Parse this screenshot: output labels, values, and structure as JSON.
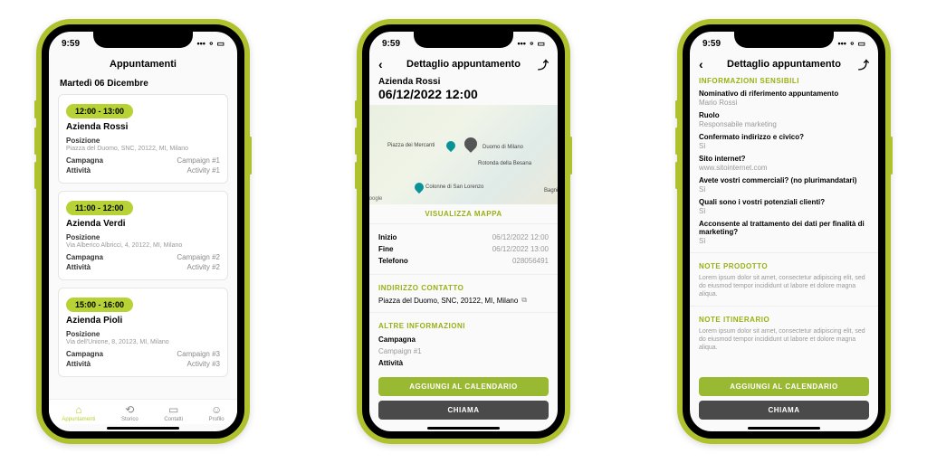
{
  "status_time": "9:59",
  "phone1": {
    "header": "Appuntamenti",
    "date": "Martedì 06 Dicembre",
    "cards": [
      {
        "time": "12:00 - 13:00",
        "company": "Azienda Rossi",
        "pos_l": "Posizione",
        "pos_v": "Piazza del Duomo, SNC, 20122, MI, Milano",
        "camp_l": "Campagna",
        "camp_v": "Campaign #1",
        "act_l": "Attività",
        "act_v": "Activity #1"
      },
      {
        "time": "11:00 - 12:00",
        "company": "Azienda Verdi",
        "pos_l": "Posizione",
        "pos_v": "Via Alberico Albricci, 4, 20122, MI, Milano",
        "camp_l": "Campagna",
        "camp_v": "Campaign #2",
        "act_l": "Attività",
        "act_v": "Activity #2"
      },
      {
        "time": "15:00 - 16:00",
        "company": "Azienda Pioli",
        "pos_l": "Posizione",
        "pos_v": "Via dell'Unione, 8, 20123, MI, Milano",
        "camp_l": "Campagna",
        "camp_v": "Campaign #3",
        "act_l": "Attività",
        "act_v": "Activity #3"
      }
    ],
    "nav": [
      "Appuntamenti",
      "Storico",
      "Contatti",
      "Profilo"
    ]
  },
  "phone2": {
    "header": "Dettaglio appuntamento",
    "company": "Azienda Rossi",
    "datetime": "06/12/2022 12:00",
    "map_labels": {
      "a": "Piazza dei Mercanti",
      "b": "Duomo di Milano",
      "c": "Rotonda della Besana",
      "d": "Colonne di San Lorenzo",
      "e": "Bagni M"
    },
    "map_btn": "VISUALIZZA MAPPA",
    "kv": [
      {
        "k": "Inizio",
        "v": "06/12/2022 12:00"
      },
      {
        "k": "Fine",
        "v": "06/12/2022 13:00"
      },
      {
        "k": "Telefono",
        "v": "028056491"
      }
    ],
    "addr_hdr": "INDIRIZZO CONTATTO",
    "addr": "Piazza del Duomo, SNC, 20122, MI, Milano",
    "other_hdr": "ALTRE INFORMAZIONI",
    "other": [
      {
        "k": "Campagna",
        "v": "Campaign #1"
      },
      {
        "k": "Attività",
        "v": "Activity #1"
      }
    ],
    "btn1": "AGGIUNGI AL CALENDARIO",
    "btn2": "CHIAMA"
  },
  "phone3": {
    "header": "Dettaglio appuntamento",
    "sec1": "INFORMAZIONI SENSIBILI",
    "qa": [
      {
        "q": "Nominativo di riferimento appuntamento",
        "a": "Mario Rossi"
      },
      {
        "q": "Ruolo",
        "a": "Responsabile marketing"
      },
      {
        "q": "Confermato indirizzo e civico?",
        "a": "Sì"
      },
      {
        "q": "Sito internet?",
        "a": "www.sitointernet.com"
      },
      {
        "q": "Avete vostri commerciali? (no plurimandatari)",
        "a": "Sì"
      },
      {
        "q": "Quali sono i vostri potenziali clienti?",
        "a": "Sì"
      },
      {
        "q": "Acconsente al trattamento dei dati per finalità di marketing?",
        "a": "Sì"
      }
    ],
    "sec2": "NOTE PRODOTTO",
    "note2": "Lorem ipsum dolor sit amet, consectetur adipiscing elit, sed do eiusmod tempor incididunt ut labore et dolore magna aliqua.",
    "sec3": "NOTE ITINERARIO",
    "note3": "Lorem ipsum dolor sit amet, consectetur adipiscing elit, sed do eiusmod tempor incididunt ut labore et dolore magna aliqua.",
    "btn1": "AGGIUNGI AL CALENDARIO",
    "btn2": "CHIAMA"
  }
}
